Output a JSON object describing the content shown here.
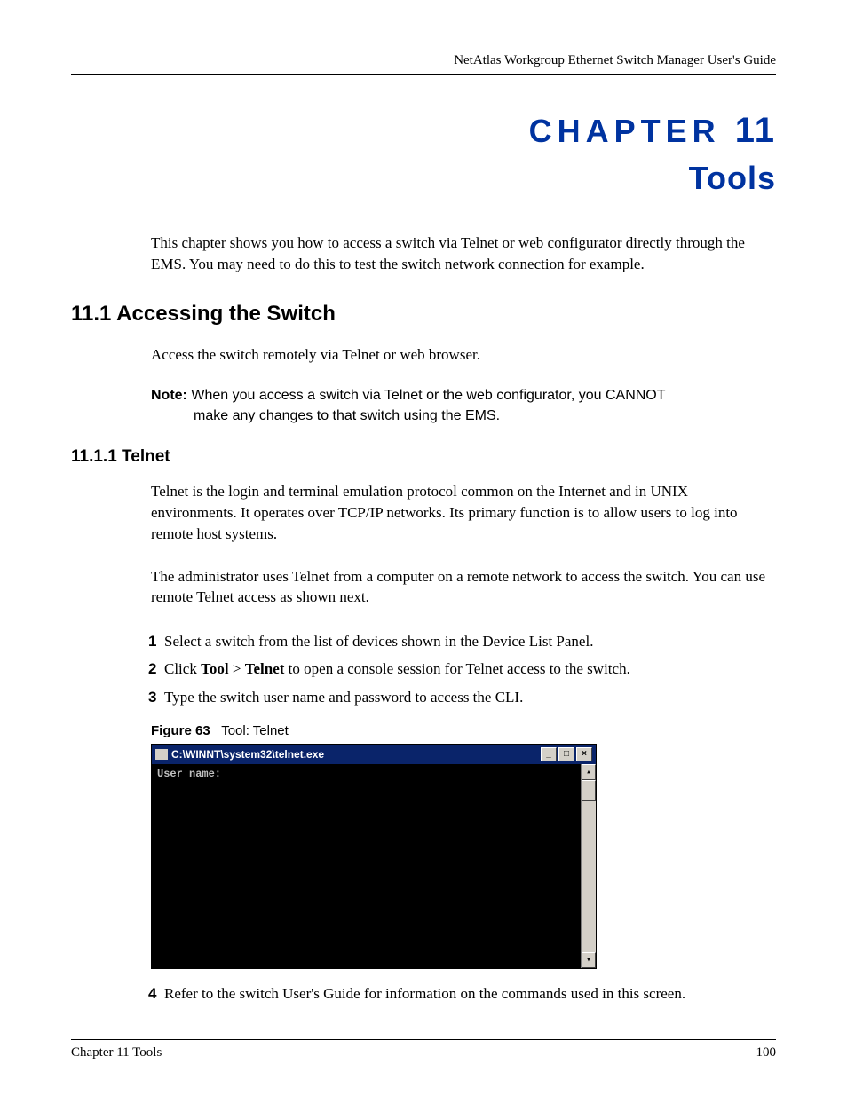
{
  "header": {
    "running_head": "NetAtlas Workgroup Ethernet Switch Manager User's Guide"
  },
  "chapter": {
    "label": "CHAPTER",
    "number": "11",
    "name": "Tools"
  },
  "intro_para": "This chapter shows you how to access a switch via Telnet or web configurator directly through the EMS. You may need to do this to test the switch network connection for example.",
  "section_11_1": {
    "heading": "11.1  Accessing the Switch",
    "para": "Access the switch remotely via Telnet or web browser.",
    "note_label": "Note:",
    "note_line1": "When you access a switch via Telnet or the web configurator, you CANNOT",
    "note_line2": "make any changes to that switch using the EMS."
  },
  "section_11_1_1": {
    "heading": "11.1.1  Telnet",
    "para1": "Telnet is the login and terminal emulation protocol common on the Internet and in UNIX environments. It operates over TCP/IP networks. Its primary function is to allow users to log into remote host systems.",
    "para2": "The administrator uses Telnet from a computer on a remote network to access the switch. You can use remote Telnet access as shown next.",
    "steps": [
      {
        "n": "1",
        "text": "Select a switch from the list of devices shown in the Device List Panel."
      },
      {
        "n": "2",
        "pre": "Click ",
        "b1": "Tool",
        "mid": " > ",
        "b2": "Telnet",
        "post": " to open a console session for Telnet access to the switch."
      },
      {
        "n": "3",
        "text": "Type the switch user name and password to access the CLI."
      }
    ],
    "figure": {
      "label": "Figure 63",
      "caption": "Tool: Telnet"
    },
    "telnet_window": {
      "title": "C:\\WINNT\\system32\\telnet.exe",
      "prompt": "User name:",
      "btn_min": "_",
      "btn_max": "□",
      "btn_close": "×",
      "scroll_up": "▴",
      "scroll_down": "▾"
    },
    "step4": {
      "n": "4",
      "text": "Refer to the switch User's Guide for information on the commands used in this screen."
    }
  },
  "footer": {
    "left": "Chapter 11 Tools",
    "right": "100"
  }
}
